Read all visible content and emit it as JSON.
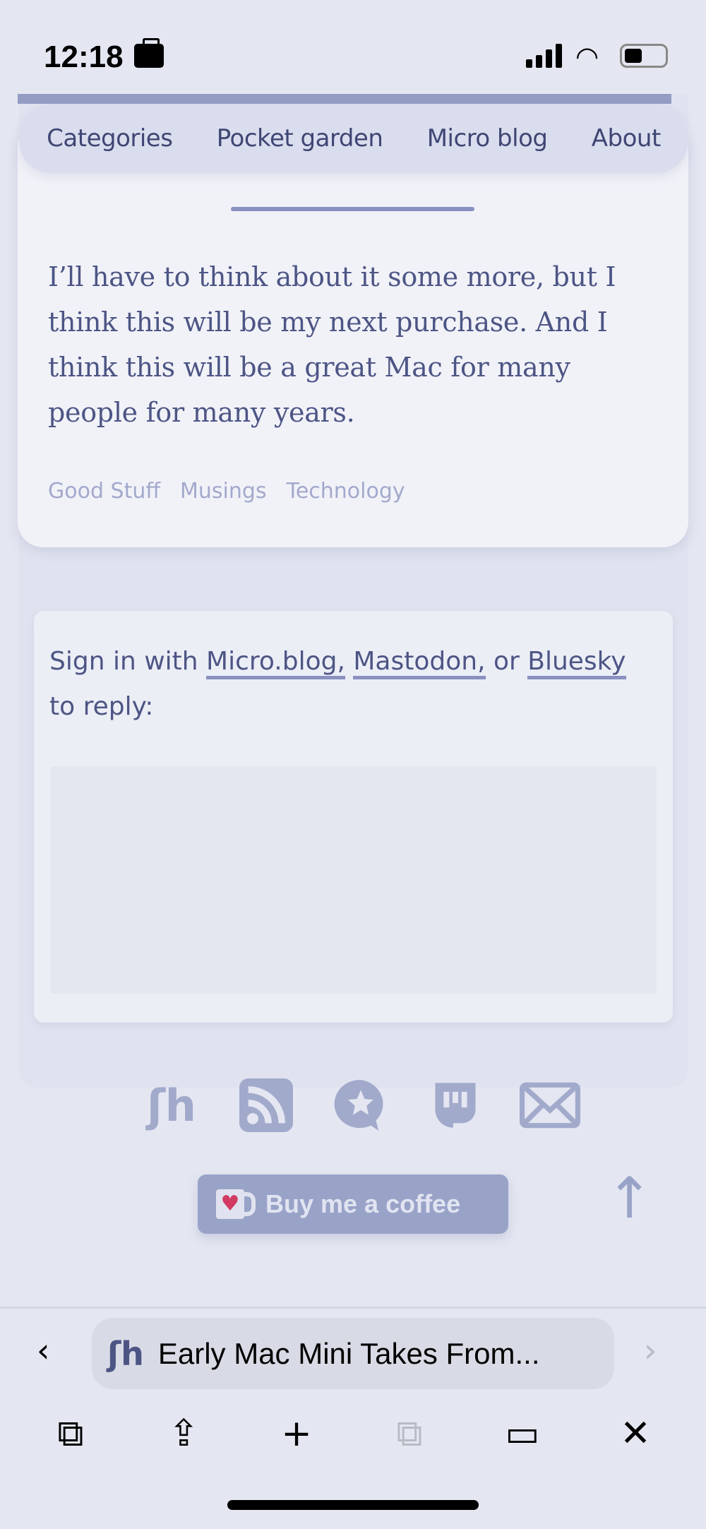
{
  "status_bar": {
    "time": "12:18"
  },
  "nav": {
    "items": [
      "Categories",
      "Pocket garden",
      "Micro blog",
      "About"
    ]
  },
  "post": {
    "body": "I’ll have to think about it some more, but I think this will be my next purchase. And I think this will be a great Mac for many people for many years.",
    "tags": [
      "Good Stuff",
      "Musings",
      "Technology"
    ]
  },
  "reply": {
    "prefix": "Sign in with ",
    "link1": "Micro.blog,",
    "sep": " ",
    "link2": "Mastodon,",
    "mid": " or ",
    "link3": "Bluesky",
    "suffix": " to reply:"
  },
  "footer": {
    "icons": [
      "site-logo-icon",
      "rss-icon",
      "microblog-icon",
      "mastodon-icon",
      "mail-icon"
    ],
    "coffee_label": "Buy me a coffee"
  },
  "browser": {
    "page_title": "Early Mac Mini Takes From..."
  },
  "colors": {
    "accent": "#8891c0",
    "text": "#4d5585",
    "background": "#e4e6f1",
    "heart": "#d13a63"
  }
}
